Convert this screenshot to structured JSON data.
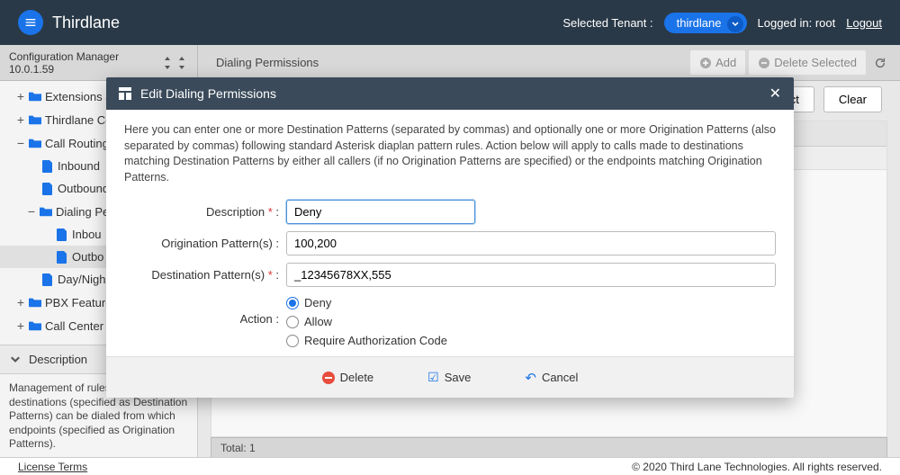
{
  "header": {
    "brand": "Thirdlane",
    "selected_tenant_label": "Selected Tenant :",
    "tenant_name": "thirdlane",
    "logged_in_label": "Logged in: root",
    "logout": "Logout"
  },
  "secondary": {
    "config_label": "Configuration Manager 10.0.1.59",
    "crumb": "Dialing Permissions",
    "add_label": "Add",
    "delete_label": "Delete Selected"
  },
  "tree": {
    "items": [
      {
        "label": "Extensions a",
        "level": 1,
        "type": "folder",
        "exp": "+"
      },
      {
        "label": "Thirdlane Co",
        "level": 1,
        "type": "folder",
        "exp": "+"
      },
      {
        "label": "Call Routing",
        "level": 1,
        "type": "folder",
        "exp": "−"
      },
      {
        "label": "Inbound",
        "level": 2,
        "type": "file",
        "exp": ""
      },
      {
        "label": "Outbound",
        "level": 2,
        "type": "file",
        "exp": ""
      },
      {
        "label": "Dialing Pe",
        "level": 2,
        "type": "folder",
        "exp": "−"
      },
      {
        "label": "Inbou",
        "level": 3,
        "type": "file",
        "exp": ""
      },
      {
        "label": "Outbo",
        "level": 3,
        "type": "file",
        "exp": "",
        "selected": true
      },
      {
        "label": "Day/Nigh",
        "level": 2,
        "type": "file",
        "exp": ""
      },
      {
        "label": "PBX Features",
        "level": 1,
        "type": "folder",
        "exp": "+"
      },
      {
        "label": "Call Center",
        "level": 1,
        "type": "folder",
        "exp": "+"
      }
    ],
    "desc_header": "Description",
    "desc_body": "Management of rules which destinations (specified as Destination Patterns) can be dialed from which endpoints (specified as Origination Patterns)."
  },
  "content": {
    "select_label": "ect",
    "clear_label": "Clear",
    "total_label": "Total: 1"
  },
  "modal": {
    "title": "Edit Dialing Permissions",
    "desc": "Here you can enter one or more Destination Patterns (separated by commas) and optionally one or more Origination Patterns (also separated by commas) following standard Asterisk diaplan pattern rules. Action below will apply to calls made to destinations matching Destination Patterns by either all callers (if no Origination Patterns are specified) or the endpoints matching Origination Patterns.",
    "fields": {
      "description_label": "Description",
      "description_value": "Deny",
      "origination_label": "Origination Pattern(s) :",
      "origination_value": "100,200",
      "destination_label": "Destination Pattern(s)",
      "destination_value": "_12345678XX,555",
      "action_label": "Action :",
      "action_options": [
        "Deny",
        "Allow",
        "Require Authorization Code"
      ],
      "action_selected": 0
    },
    "buttons": {
      "delete": "Delete",
      "save": "Save",
      "cancel": "Cancel"
    }
  },
  "footer": {
    "license": "License Terms",
    "copyright": "© 2020 Third Lane Technologies. All rights reserved."
  }
}
